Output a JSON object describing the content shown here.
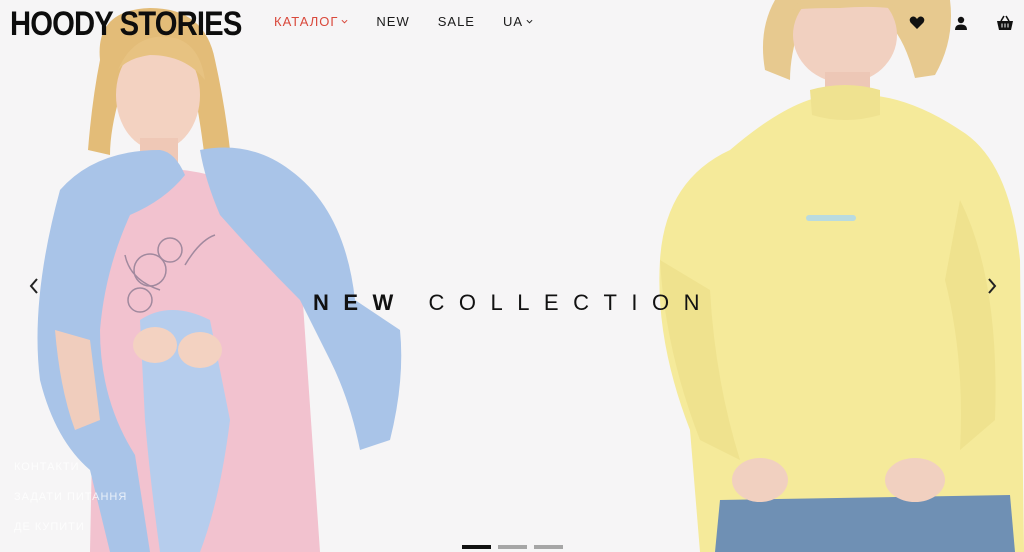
{
  "brand": {
    "logo_text": "HOODY STORIES"
  },
  "nav": {
    "items": [
      {
        "label": "КАТАЛОГ",
        "has_dropdown": true,
        "active": true
      },
      {
        "label": "NEW",
        "has_dropdown": false
      },
      {
        "label": "SALE",
        "has_dropdown": false
      },
      {
        "label": "UA",
        "has_dropdown": true
      }
    ]
  },
  "header_icons": [
    "heart-icon",
    "user-icon",
    "basket-icon"
  ],
  "hero": {
    "headline_bold": "NEW",
    "headline_rest": "COLLECTION",
    "prev_icon": "chevron-left-icon",
    "next_icon": "chevron-right-icon",
    "slides_count": 3,
    "active_slide": 1
  },
  "side_links": [
    "КОНТАКТИ",
    "ЗАДАТИ ПИТАННЯ",
    "ДЕ КУПИТИ"
  ],
  "colors": {
    "accent": "#d9483b",
    "text": "#111111",
    "background": "#f6f5f6",
    "hoodie_blue": "#a9c4e8",
    "tee_pink": "#f2c2cf",
    "sweater_yellow": "#f5ea9a"
  }
}
